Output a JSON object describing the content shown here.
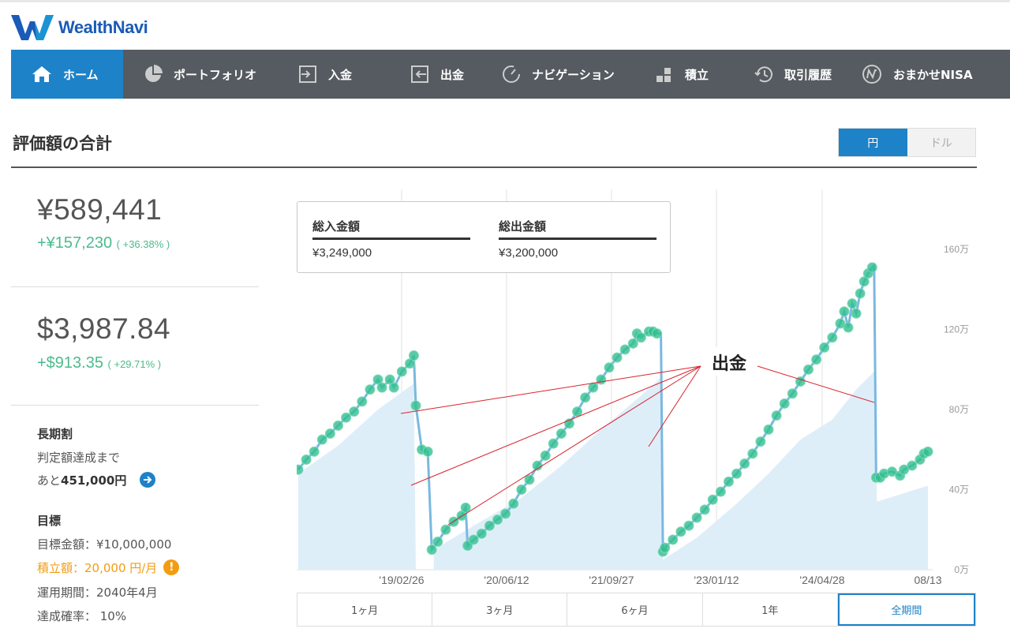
{
  "header": {
    "brand": "WealthNavi"
  },
  "nav": [
    {
      "label": "ホーム",
      "icon": "home-icon",
      "active": true
    },
    {
      "label": "ポートフォリオ",
      "icon": "pie-chart-icon"
    },
    {
      "label": "入金",
      "icon": "deposit-icon"
    },
    {
      "label": "出金",
      "icon": "withdraw-icon"
    },
    {
      "label": "ナビゲーション",
      "icon": "navigation-icon"
    },
    {
      "label": "積立",
      "icon": "stack-icon"
    },
    {
      "label": "取引履歴",
      "icon": "history-icon"
    },
    {
      "label": "おまかせNISA",
      "icon": "nisa-icon"
    }
  ],
  "page": {
    "title": "評価額の合計",
    "currency_yen": "円",
    "currency_usd": "ドル"
  },
  "summary": {
    "jpy_value": "¥589,441",
    "jpy_gain": "+¥157,230",
    "jpy_gain_pct": "( +36.38% )",
    "usd_value": "$3,987.84",
    "usd_gain": "+$913.35",
    "usd_gain_pct": "( +29.71% )",
    "long_term_title": "長期割",
    "long_term_line1": "判定額達成まで",
    "long_term_prefix": "あと",
    "long_term_amount": "451,000円",
    "goal_title": "目標",
    "goal_amount": "目標金額：¥10,000,000",
    "goal_monthly": "積立額：20,000 円/月",
    "goal_period": "運用期間：2040年4月",
    "goal_prob": "達成確率： 10%"
  },
  "legend": {
    "deposit_label": "総入金額",
    "deposit_value": "¥3,249,000",
    "withdraw_label": "総出金額",
    "withdraw_value": "¥3,200,000"
  },
  "annotation": {
    "label": "出金"
  },
  "periods": [
    "1ヶ月",
    "3ヶ月",
    "6ヶ月",
    "1年",
    "全期間"
  ],
  "colors": {
    "nav_bg": "#555b60",
    "accent": "#1d82c8",
    "gain": "#4cba8d",
    "warning": "#f39c12",
    "line": "#7ab8e0",
    "marker": "#2fbf8f",
    "area": "#deeef9",
    "annotation_line": "#d9232d"
  },
  "chart_data": {
    "type": "line",
    "x_ticks": [
      "'19/02/26",
      "'20/06/12",
      "'21/09/27",
      "'23/01/12",
      "'24/04/28",
      "08/13"
    ],
    "y_ticks": [
      "0万",
      "40万",
      "80万",
      "120万",
      "160万"
    ],
    "ylim": [
      0,
      190
    ],
    "y_unit": "万",
    "series": [
      {
        "kind": "valuation",
        "points": [
          [
            0,
            50
          ],
          [
            2,
            55
          ],
          [
            4,
            59
          ],
          [
            6,
            65
          ],
          [
            8,
            68
          ],
          [
            10,
            72
          ],
          [
            12,
            76
          ],
          [
            14,
            79
          ],
          [
            16,
            84
          ],
          [
            18,
            90
          ],
          [
            20,
            95
          ],
          [
            21,
            91
          ],
          [
            23,
            95
          ],
          [
            24,
            91
          ],
          [
            26,
            99
          ],
          [
            28,
            103
          ],
          [
            29,
            107
          ],
          [
            29.5,
            82
          ],
          [
            31,
            60
          ],
          [
            32.5,
            59
          ],
          [
            33.5,
            10
          ],
          [
            35,
            14
          ],
          [
            37,
            20
          ],
          [
            39,
            24
          ],
          [
            41,
            27
          ],
          [
            42,
            31
          ],
          [
            42.5,
            12
          ],
          [
            44,
            15
          ],
          [
            46,
            18
          ],
          [
            48,
            22
          ],
          [
            50,
            25
          ],
          [
            52,
            28
          ],
          [
            54,
            33
          ],
          [
            56,
            40
          ],
          [
            58,
            45
          ],
          [
            60,
            52
          ],
          [
            62,
            57
          ],
          [
            64,
            63
          ],
          [
            66,
            68
          ],
          [
            68,
            73
          ],
          [
            70,
            79
          ],
          [
            72,
            86
          ],
          [
            74,
            91
          ],
          [
            76,
            95
          ],
          [
            78,
            101
          ],
          [
            80,
            106
          ],
          [
            82,
            110
          ],
          [
            84,
            113
          ],
          [
            85,
            118
          ],
          [
            86,
            116
          ],
          [
            88,
            119
          ],
          [
            89,
            119
          ],
          [
            90,
            118
          ],
          [
            91,
            118
          ],
          [
            91.5,
            9
          ],
          [
            92,
            11
          ],
          [
            94,
            15
          ],
          [
            96,
            19
          ],
          [
            98,
            22
          ],
          [
            100,
            26
          ],
          [
            102,
            30
          ],
          [
            104,
            35
          ],
          [
            106,
            39
          ],
          [
            108,
            44
          ],
          [
            110,
            48
          ],
          [
            112,
            53
          ],
          [
            114,
            58
          ],
          [
            116,
            64
          ],
          [
            118,
            70
          ],
          [
            120,
            77
          ],
          [
            122,
            83
          ],
          [
            124,
            88
          ],
          [
            126,
            94
          ],
          [
            128,
            100
          ],
          [
            130,
            105
          ],
          [
            132,
            111
          ],
          [
            134,
            116
          ],
          [
            136,
            123
          ],
          [
            137,
            129
          ],
          [
            138,
            121
          ],
          [
            139,
            133
          ],
          [
            140,
            128
          ],
          [
            141,
            138
          ],
          [
            142,
            144
          ],
          [
            143,
            148
          ],
          [
            144,
            151
          ],
          [
            144.5,
            152
          ],
          [
            145,
            46
          ],
          [
            146,
            46
          ],
          [
            147,
            48
          ],
          [
            149,
            49
          ],
          [
            151,
            47
          ],
          [
            152,
            50
          ],
          [
            154,
            52
          ],
          [
            156,
            55
          ],
          [
            157,
            58
          ],
          [
            158,
            59
          ]
        ]
      },
      {
        "kind": "deposit",
        "points": [
          [
            0,
            48
          ],
          [
            10,
            62
          ],
          [
            20,
            80
          ],
          [
            29,
            93
          ],
          [
            29.5,
            0
          ],
          [
            34,
            0
          ],
          [
            34,
            10
          ],
          [
            44,
            22
          ],
          [
            56,
            36
          ],
          [
            66,
            52
          ],
          [
            76,
            70
          ],
          [
            86,
            87
          ],
          [
            91,
            96
          ],
          [
            91.5,
            5
          ],
          [
            100,
            16
          ],
          [
            110,
            33
          ],
          [
            118,
            48
          ],
          [
            126,
            65
          ],
          [
            134,
            75
          ],
          [
            140,
            90
          ],
          [
            145,
            100
          ],
          [
            145.2,
            34
          ],
          [
            158,
            42
          ]
        ]
      }
    ],
    "annotation": "出金"
  }
}
